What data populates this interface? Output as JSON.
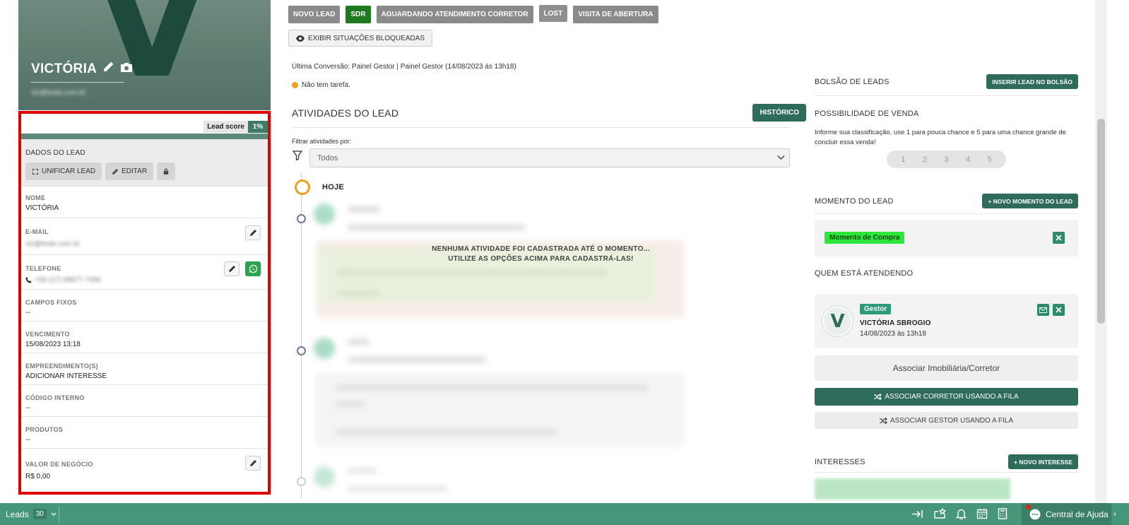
{
  "lead": {
    "initial": "V",
    "name": "VICTÓRIA",
    "email_blurred": "vic@teste.com.br",
    "score_label": "Lead score",
    "score_value": "1%",
    "score_fraction": 0.01
  },
  "dados": {
    "title": "DADOS DO LEAD",
    "unificar_label": "UNIFICAR LEAD",
    "editar_label": "EDITAR",
    "fields": [
      {
        "label": "NOME",
        "value": "VICTÓRIA"
      },
      {
        "label": "E-MAIL",
        "value": "vic@teste.com.br"
      },
      {
        "label": "TELEFONE",
        "value": "+55 (17) 98877-7456"
      },
      {
        "label": "CAMPOS FIXOS",
        "value": "--"
      },
      {
        "label": "VENCIMENTO",
        "value": "15/08/2023 13:18"
      },
      {
        "label": "EMPREENDIMENTO(S)",
        "value": "ADICIONAR INTERESSE"
      },
      {
        "label": "CÓDIGO INTERNO",
        "value": "--"
      },
      {
        "label": "PRODUTOS",
        "value": "--"
      },
      {
        "label": "VALOR DE NEGÓCIO",
        "value": "R$ 0,00"
      }
    ]
  },
  "status": {
    "tags": [
      "NOVO LEAD",
      "SDR",
      "AGUARDANDO ATENDIMENTO CORRETOR",
      "LOST",
      "VISITA DE ABERTURA"
    ],
    "exibir_label": "EXIBIR SITUAÇÕES BLOQUEADAS",
    "ultima_conversao": "Última Conversão: Painel Gestor | Painel Gestor (14/08/2023 às 13h18)",
    "tarefa": "Não tem tarefa."
  },
  "atividades": {
    "title": "ATIVIDADES DO LEAD",
    "historico_label": "HISTÓRICO",
    "filtrar_label": "Filtrar atividades por:",
    "filter_value": "Todos",
    "hoje_label": "HOJE",
    "empty_line1": "NENHUMA ATIVIDADE FOI CADASTRADA ATÉ O MOMENTO...",
    "empty_line2": "UTILIZE AS OPÇÕES ACIMA PARA CADASTRÁ-LAS!"
  },
  "right": {
    "bolsao_title": "BOLSÃO DE LEADS",
    "bolsao_btn": "INSERIR LEAD NO BOLSÃO",
    "possibilidade_title": "POSSIBILIDADE DE VENDA",
    "possibilidade_desc": "Informe sua classificação, use 1 para pouca chance e 5 para uma chance grande de concluir essa venda!",
    "rating": [
      "1",
      "2",
      "3",
      "4",
      "5"
    ],
    "momento_title": "MOMENTO DO LEAD",
    "momento_btn": "+ NOVO MOMENTO DO LEAD",
    "momento_badge": "Momento de Compra",
    "quem_title": "QUEM ESTÁ ATENDENDO",
    "quem_role": "Gestor",
    "quem_name": "VICTÓRIA SBROGIO",
    "quem_date": "14/08/2023 às 13h18",
    "quem_initial": "V",
    "assoc_imob": "Associar Imobiliária/Corretor",
    "assoc_fila": "ASSOCIAR CORRETOR USANDO A FILA",
    "assoc_gestor": "ASSOCIAR GESTOR USANDO A FILA",
    "interesses_title": "INTERESSES",
    "interesses_btn": "+ NOVO INTERESSE"
  },
  "footer": {
    "leads_label": "Leads",
    "leads_count": "30",
    "help_label": "Central de Ajuda"
  },
  "colors": {
    "brand": "#2e6b5b",
    "footer": "#46967a",
    "highlight": "#e00000",
    "sdr": "#1f7a1f",
    "momento": "#2ee63a"
  }
}
